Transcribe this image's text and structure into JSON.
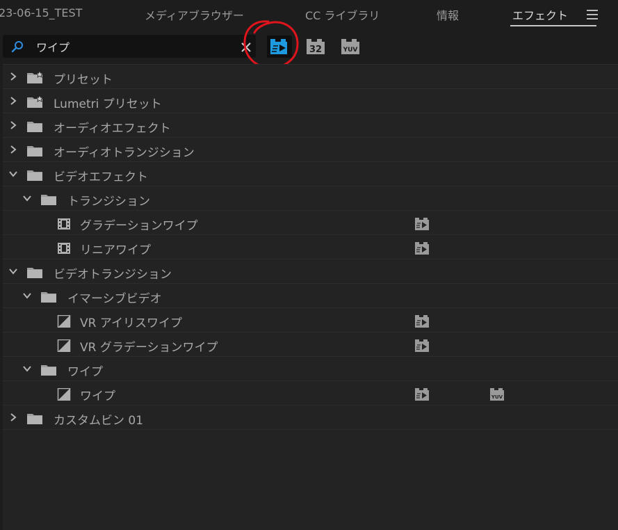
{
  "tabs": [
    {
      "label": "23-06-15_TEST",
      "active": false
    },
    {
      "label": "メディアブラウザー",
      "active": false
    },
    {
      "label": "CC ライブラリ",
      "active": false
    },
    {
      "label": "情報",
      "active": false
    },
    {
      "label": "エフェクト",
      "active": true
    }
  ],
  "search": {
    "value": "ワイプ",
    "placeholder": ""
  },
  "filters": [
    {
      "name": "accelerated-effects",
      "label": "",
      "icon": "accelerated-effects-icon",
      "active": true
    },
    {
      "name": "32-bit",
      "label": "32",
      "icon": "32bit-icon",
      "active": false
    },
    {
      "name": "yuv",
      "label": "YUV",
      "icon": "yuv-icon",
      "active": false
    }
  ],
  "colors": {
    "accent": "#1e9be0",
    "annotation": "#e0141c",
    "background": "#1d1d1d",
    "panel": "#232323",
    "text": "#a8a8a8"
  },
  "tree": [
    {
      "label": "プリセット",
      "level": 0,
      "kind": "preset-folder",
      "expanded": false
    },
    {
      "label": "Lumetri プリセット",
      "level": 0,
      "kind": "preset-folder",
      "expanded": false
    },
    {
      "label": "オーディオエフェクト",
      "level": 0,
      "kind": "folder",
      "expanded": false
    },
    {
      "label": "オーディオトランジション",
      "level": 0,
      "kind": "folder",
      "expanded": false
    },
    {
      "label": "ビデオエフェクト",
      "level": 0,
      "kind": "folder",
      "expanded": true
    },
    {
      "label": "トランジション",
      "level": 1,
      "kind": "folder",
      "expanded": true
    },
    {
      "label": "グラデーションワイプ",
      "level": 2,
      "kind": "video-effect",
      "accel": true,
      "yuv": false
    },
    {
      "label": "リニアワイプ",
      "level": 2,
      "kind": "video-effect",
      "accel": true,
      "yuv": false
    },
    {
      "label": "ビデオトランジション",
      "level": 0,
      "kind": "folder",
      "expanded": true
    },
    {
      "label": "イマーシブビデオ",
      "level": 1,
      "kind": "folder",
      "expanded": true
    },
    {
      "label": "VR アイリスワイプ",
      "level": 2,
      "kind": "video-transition",
      "accel": true,
      "yuv": false
    },
    {
      "label": "VR グラデーションワイプ",
      "level": 2,
      "kind": "video-transition",
      "accel": true,
      "yuv": false
    },
    {
      "label": "ワイプ",
      "level": 1,
      "kind": "folder",
      "expanded": true
    },
    {
      "label": "ワイプ",
      "level": 2,
      "kind": "video-transition",
      "accel": true,
      "yuv": true
    },
    {
      "label": "カスタムビン 01",
      "level": 0,
      "kind": "folder",
      "expanded": false
    }
  ]
}
